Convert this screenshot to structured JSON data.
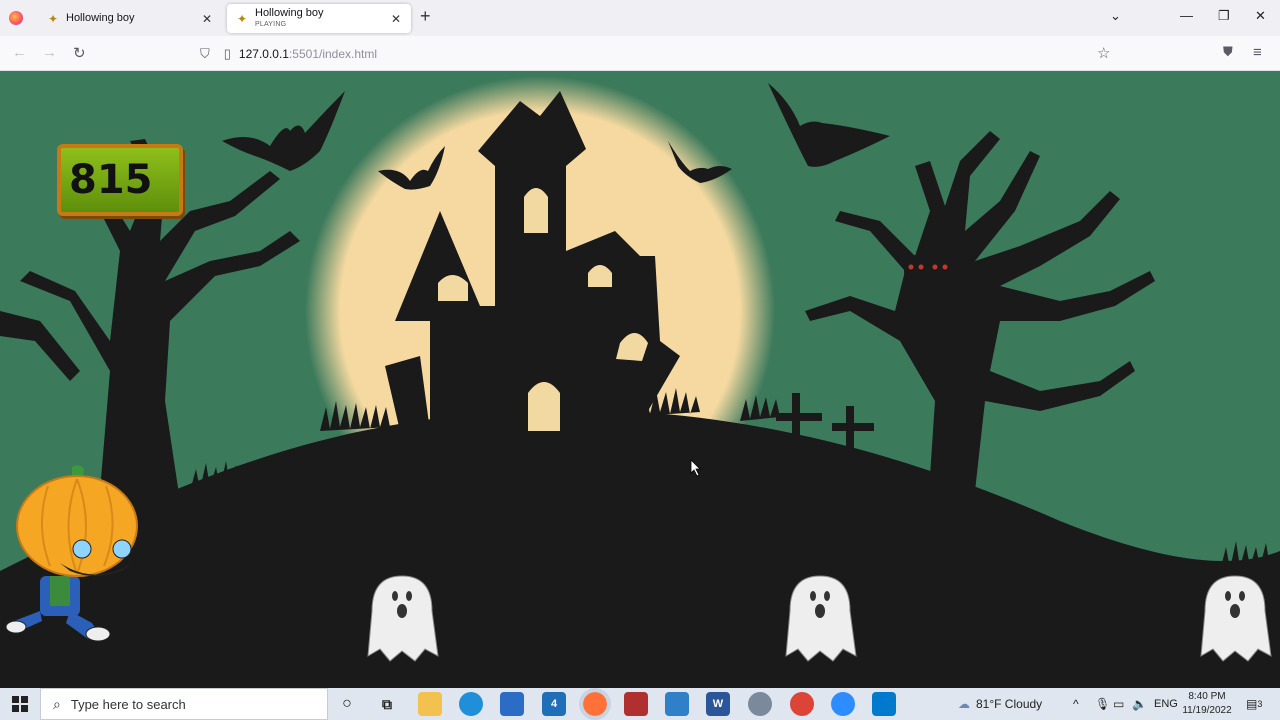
{
  "browser": {
    "tabs": [
      {
        "title": "Hollowing boy",
        "subtitle": "",
        "active": false
      },
      {
        "title": "Hollowing boy",
        "subtitle": "PLAYING",
        "active": true
      }
    ],
    "url_host": "127.0.0.1",
    "url_path": ":5501/index.html"
  },
  "game": {
    "score": "815",
    "player": "pumpkin-head-boy",
    "enemies": [
      "ghost",
      "ghost",
      "ghost"
    ],
    "scene": "haunted-house-full-moon",
    "colors": {
      "sky": "#3c7a5c",
      "moon": "#f5d9a0",
      "silhouette": "#1a1a1a",
      "window": "#f2d9a2"
    }
  },
  "taskbar": {
    "search_placeholder": "Type here to search",
    "weather": "81°F  Cloudy",
    "language": "ENG",
    "time": "8:40 PM",
    "date": "11/19/2022",
    "mail_badge": "4",
    "notification_badge": "3"
  }
}
